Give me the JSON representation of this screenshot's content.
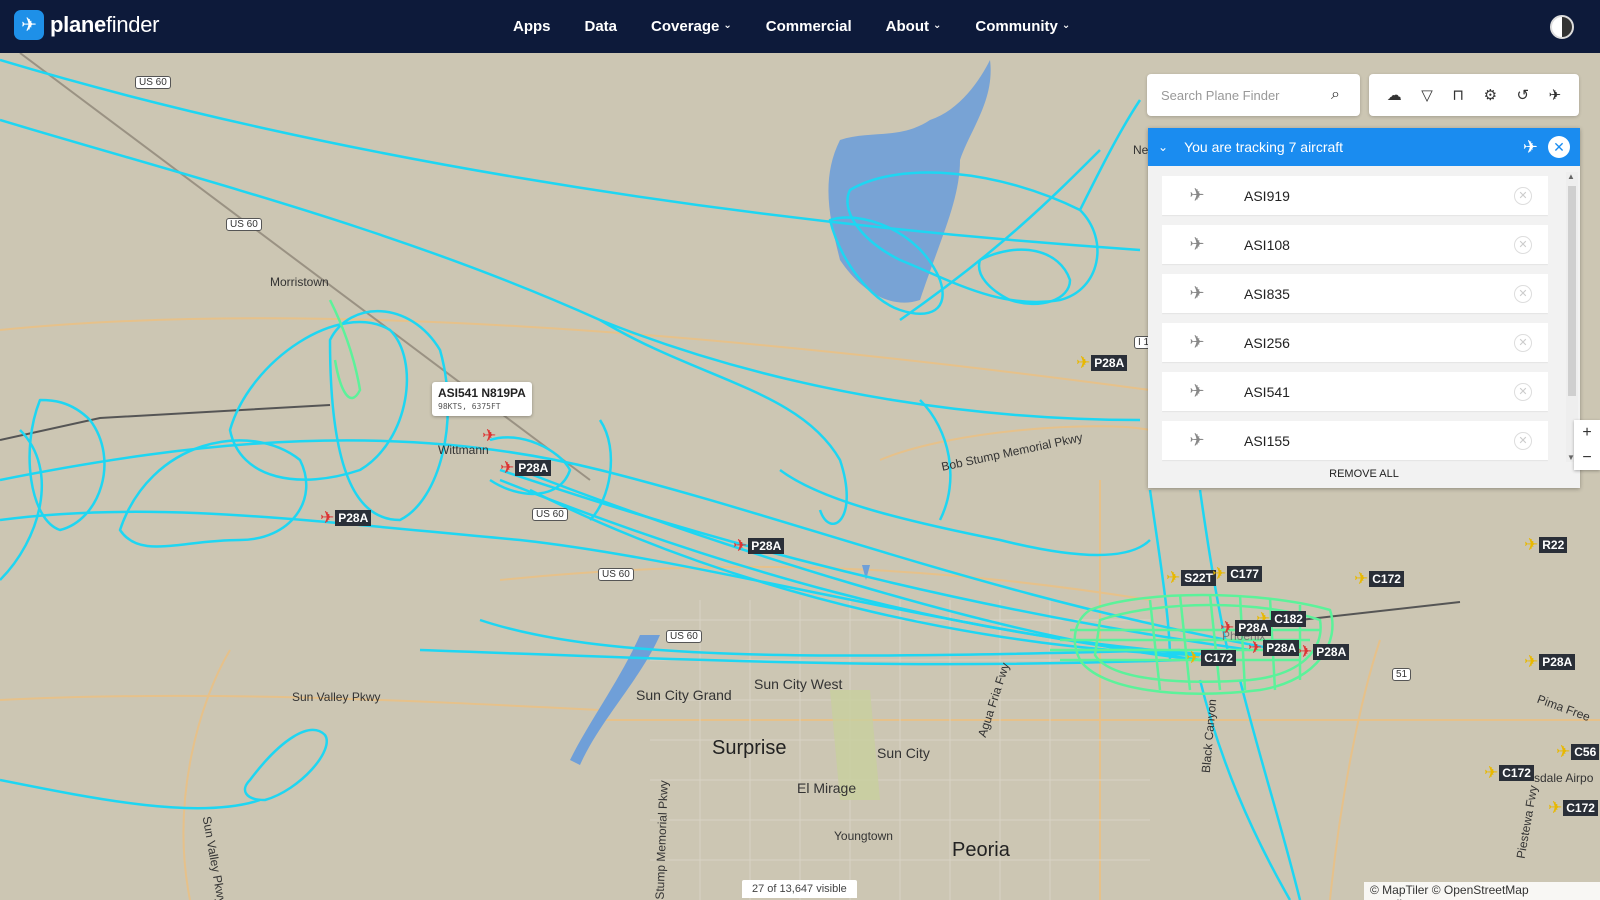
{
  "brand": {
    "name_bold": "plane",
    "name_light": "finder"
  },
  "nav": [
    {
      "label": "Apps",
      "dropdown": false
    },
    {
      "label": "Data",
      "dropdown": false
    },
    {
      "label": "Coverage",
      "dropdown": true
    },
    {
      "label": "Commercial",
      "dropdown": false
    },
    {
      "label": "About",
      "dropdown": true
    },
    {
      "label": "Community",
      "dropdown": true
    }
  ],
  "search": {
    "placeholder": "Search Plane Finder"
  },
  "tracking": {
    "title": "You are tracking 7 aircraft",
    "aircraft": [
      "ASI919",
      "ASI108",
      "ASI835",
      "ASI256",
      "ASI541",
      "ASI155"
    ],
    "remove_all": "REMOVE ALL"
  },
  "tooltip": {
    "callsign": "ASI541 N819PA",
    "details": "98KTS, 6375FT"
  },
  "places": {
    "surprise": "Surprise",
    "peoria": "Peoria",
    "sun_city": "Sun City",
    "sun_city_west": "Sun City West",
    "sun_city_grand": "Sun City Grand",
    "el_mirage": "El Mirage",
    "youngtown": "Youngtown",
    "wittmann": "Wittmann",
    "morristown": "Morristown",
    "sun_valley_pkwy": "Sun Valley Pkwy",
    "bob_stump": "Bob Stump Memorial Pkwy",
    "agua_fria": "Agua Fria Fwy",
    "black_canyon": "Black Canyon",
    "piestewa": "Piestewa Fwy",
    "pima": "Pima Free",
    "scottsdale": "sdale Airpo",
    "ne": "Ne",
    "sun_valley_pk2": "Sun Valley Pkwy",
    "stump_memorial": "Stump Memorial Pkwy",
    "phoenix": "Phoenix"
  },
  "shields": {
    "us60": "US 60",
    "i17": "I 1",
    "r51": "51"
  },
  "planes": [
    {
      "type": "P28A",
      "color": "#d33"
    },
    {
      "type": "P28A",
      "color": "#d33"
    },
    {
      "type": "P28A",
      "color": "#d33"
    },
    {
      "type": "P28A",
      "color": "#e8b800"
    },
    {
      "type": "S22T",
      "color": "#e8b800"
    },
    {
      "type": "C177",
      "color": "#e8b800"
    },
    {
      "type": "C172",
      "color": "#e8b800"
    },
    {
      "type": "C182",
      "color": "#e8b800"
    },
    {
      "type": "P28A",
      "color": "#d33"
    },
    {
      "type": "P28A",
      "color": "#d33"
    },
    {
      "type": "P28A",
      "color": "#d33"
    },
    {
      "type": "C172",
      "color": "#e8b800"
    },
    {
      "type": "R22",
      "color": "#e8b800"
    },
    {
      "type": "P28A",
      "color": "#e8b800"
    },
    {
      "type": "C172",
      "color": "#e8b800"
    },
    {
      "type": "C172",
      "color": "#e8b800"
    },
    {
      "type": "C56",
      "color": "#e8b800"
    }
  ],
  "visible_count": "27 of 13,647 visible",
  "attribution": "© MapTiler © OpenStreetMap contributors",
  "colors": {
    "header": "#0d1a3a",
    "accent": "#1a8cf0",
    "track": "#1ed6f2",
    "track_local": "#5cf29a",
    "water": "#6f9fd8"
  }
}
